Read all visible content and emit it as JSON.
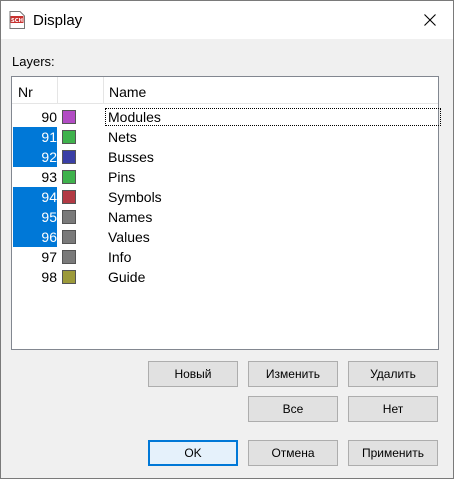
{
  "window": {
    "title": "Display",
    "icon": "sch-app-icon"
  },
  "layers_label": "Layers:",
  "columns": {
    "nr": "Nr",
    "color": "",
    "name": "Name"
  },
  "layers": [
    {
      "nr": "90",
      "name": "Modules",
      "color": "#b24cc4",
      "selected": false,
      "focused": true
    },
    {
      "nr": "91",
      "name": "Nets",
      "color": "#3fb24c",
      "selected": true,
      "focused": false
    },
    {
      "nr": "92",
      "name": "Busses",
      "color": "#3a3fa6",
      "selected": true,
      "focused": false
    },
    {
      "nr": "93",
      "name": "Pins",
      "color": "#3fb24c",
      "selected": false,
      "focused": false
    },
    {
      "nr": "94",
      "name": "Symbols",
      "color": "#b23a44",
      "selected": true,
      "focused": false
    },
    {
      "nr": "95",
      "name": "Names",
      "color": "#7a7a7a",
      "selected": true,
      "focused": false
    },
    {
      "nr": "96",
      "name": "Values",
      "color": "#7a7a7a",
      "selected": true,
      "focused": false
    },
    {
      "nr": "97",
      "name": "Info",
      "color": "#7a7a7a",
      "selected": false,
      "focused": false
    },
    {
      "nr": "98",
      "name": "Guide",
      "color": "#9c9a3a",
      "selected": false,
      "focused": false
    }
  ],
  "buttons": {
    "new": "Новый",
    "change": "Изменить",
    "delete": "Удалить",
    "all": "Все",
    "none": "Нет",
    "ok": "OK",
    "cancel": "Отмена",
    "apply": "Применить"
  },
  "colors": {
    "selection": "#0078d7",
    "accent_border": "#0078d7"
  }
}
